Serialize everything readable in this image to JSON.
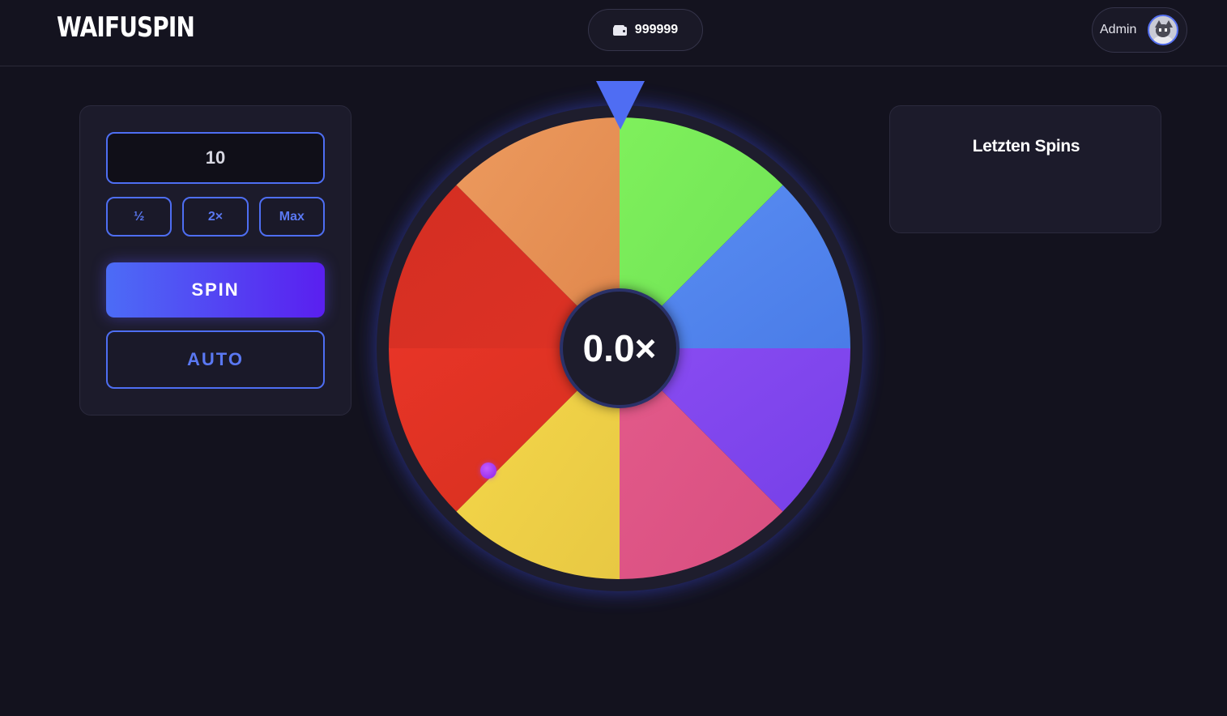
{
  "header": {
    "logo": "WAIFUSPIN",
    "balance": "999999",
    "balance_icon": "wallet-icon",
    "username": "Admin",
    "avatar_icon": "cat-avatar"
  },
  "bet_panel": {
    "bet_value": "10",
    "half_label": "½",
    "double_label": "2×",
    "max_label": "Max",
    "spin_label": "SPIN",
    "auto_label": "AUTO"
  },
  "wheel": {
    "multiplier": "0.0×",
    "segments": [
      {
        "color": "#7ff05c",
        "color2": "#6fe255"
      },
      {
        "color": "#5a8ef2",
        "color2": "#4a7ce8"
      },
      {
        "color": "#8a4cf2",
        "color2": "#7640e8"
      },
      {
        "color": "#e35a8a",
        "color2": "#d84f80"
      },
      {
        "color": "#f5d84a",
        "color2": "#e8c843"
      },
      {
        "color": "#e73427",
        "color2": "#d6311f"
      },
      {
        "color": "#d42e22",
        "color2": "#dd3225"
      },
      {
        "color": "#ec9a5e",
        "color2": "#e0874c"
      }
    ],
    "pointer_color": "#4f6df3"
  },
  "recent": {
    "title": "Letzten Spins"
  },
  "colors": {
    "background": "#13121e",
    "panel": "#1c1b2b",
    "accent": "#4e6ef2"
  }
}
